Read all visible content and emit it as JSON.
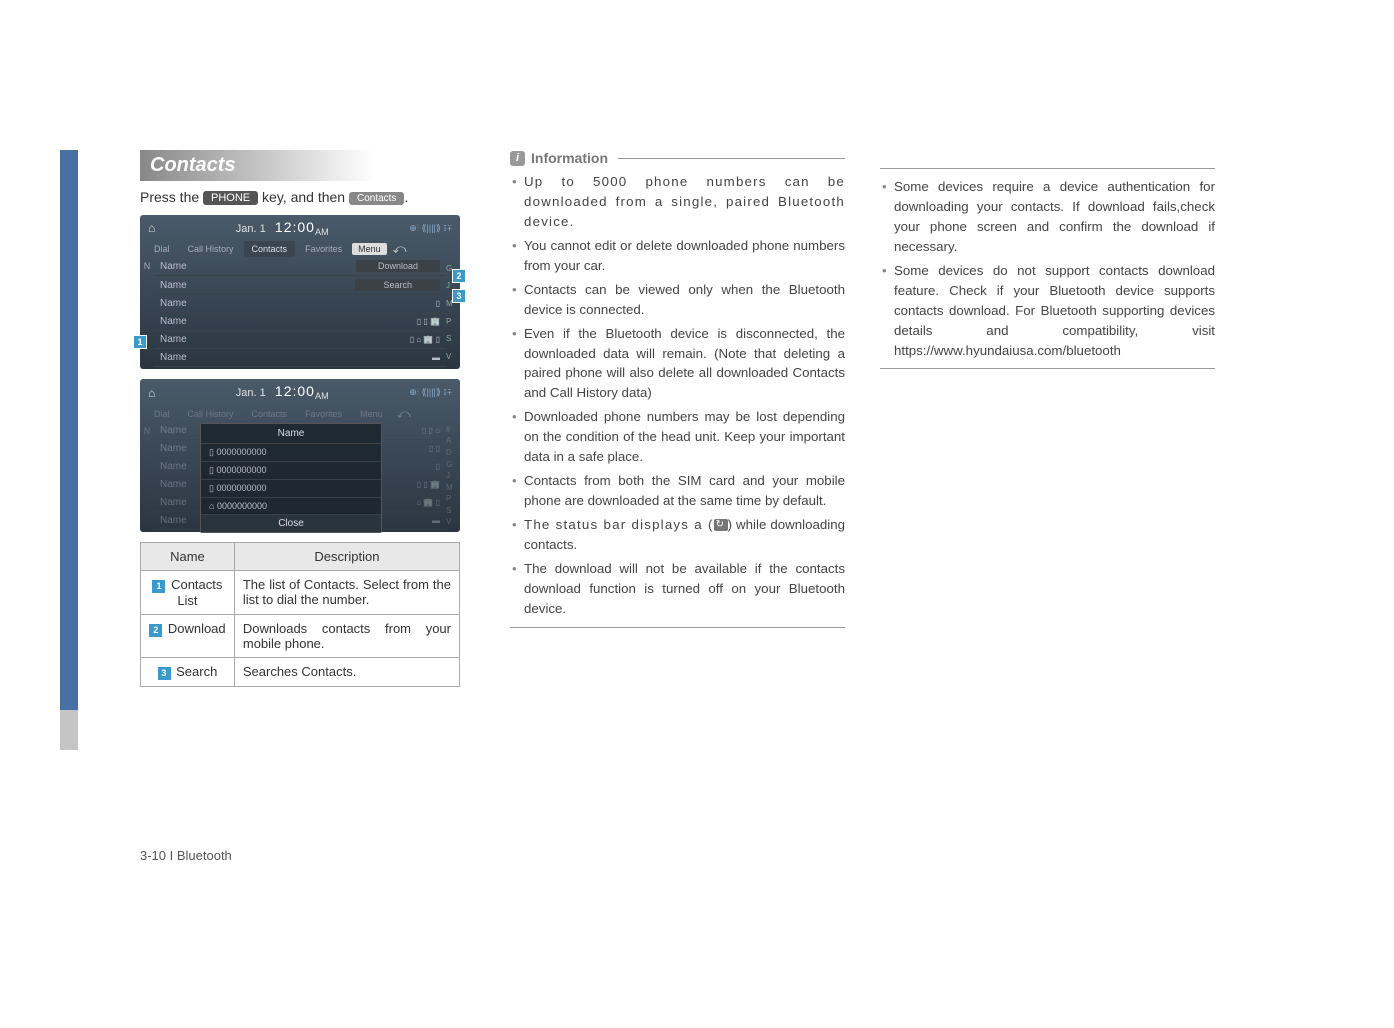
{
  "section_title": "Contacts",
  "instruction": {
    "prefix": "Press the",
    "key1": "PHONE",
    "mid": "key, and then",
    "key2": "Contacts"
  },
  "footer": "3-10 I Bluetooth",
  "screenshot1": {
    "date": "Jan. 1",
    "time": "12:00",
    "ampm": "AM",
    "tabs": {
      "dial": "Dial",
      "call_history": "Call History",
      "contacts": "Contacts",
      "favorites": "Favorites"
    },
    "menu": "Menu",
    "left_letter": "N",
    "row_download": "Download",
    "row_search": "Search",
    "row_name": "Name",
    "right_letters": [
      "G",
      "J",
      "M",
      "P",
      "S",
      "V"
    ]
  },
  "screenshot2": {
    "date": "Jan. 1",
    "time": "12:00",
    "ampm": "AM",
    "tabs": {
      "dial": "Dial",
      "call_history": "Call History",
      "contacts": "Contacts",
      "favorites": "Favorites"
    },
    "menu": "Menu",
    "left_letter": "N",
    "row_name": "Name",
    "popup_name": "Name",
    "popup_num": "0000000000",
    "popup_close": "Close",
    "right_letters": [
      "#",
      "A",
      "D",
      "G",
      "J",
      "M",
      "P",
      "S",
      "V"
    ]
  },
  "table": {
    "headers": {
      "name": "Name",
      "desc": "Description"
    },
    "rows": [
      {
        "num": "1",
        "name": "Contacts List",
        "desc": "The list of Contacts. Select from the list to dial the number."
      },
      {
        "num": "2",
        "name": "Download",
        "desc": "Downloads contacts from your mobile phone."
      },
      {
        "num": "3",
        "name": "Search",
        "desc": "Searches Contacts."
      }
    ]
  },
  "info_label": "Information",
  "col2_bullets": [
    "Up to 5000 phone numbers can be downloaded from a single, paired Bluetooth device.",
    "You cannot edit or delete downloaded phone numbers from your car.",
    "Contacts can be viewed only when the Bluetooth device is connected.",
    "Even if the Bluetooth device is disconnected, the downloaded data will remain. (Note that deleting a paired phone will also delete all downloaded Contacts and Call History data)",
    "Downloaded phone numbers may be lost depending on the condition of the head unit. Keep your important data in a safe place.",
    "Contacts from both the SIM card and your mobile phone are downloaded at the same time by default.",
    "__STATUS_ICON__",
    "The download will not be available if the contacts download function is turned off on your Bluetooth device."
  ],
  "col2_status_line": {
    "pre": "The status bar displays a (",
    "post": ") while downloading contacts."
  },
  "col3_bullets": [
    "Some devices require a device authentication for downloading your contacts. If download fails,check your phone screen and confirm the download if necessary.",
    "Some devices do not support contacts download feature. Check if your Bluetooth device supports contacts download. For Bluetooth supporting devices details and compatibility, visit https://www.hyundaiusa.com/bluetooth"
  ]
}
